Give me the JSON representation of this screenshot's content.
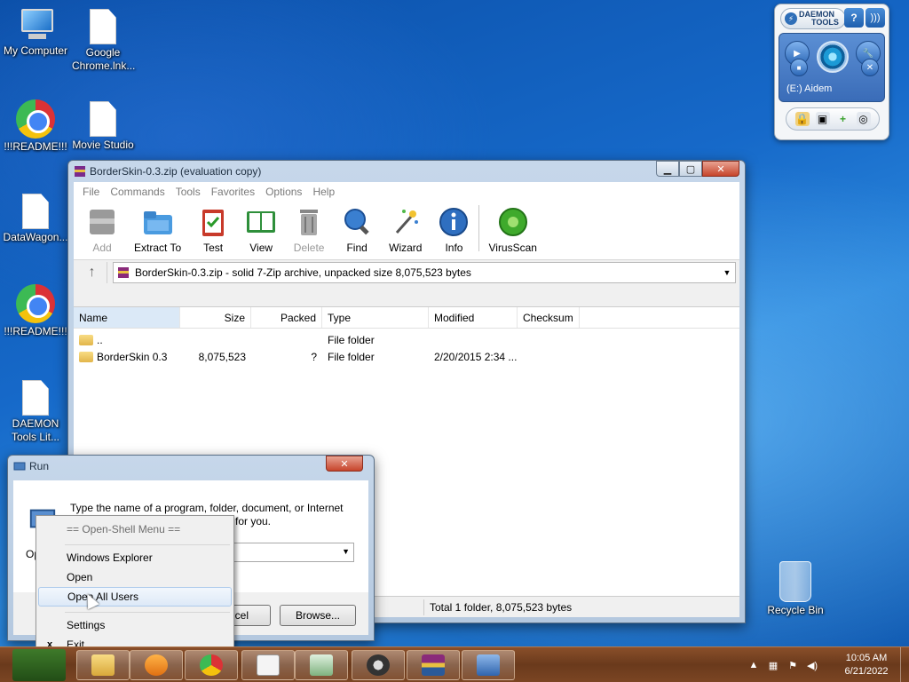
{
  "desktop": {
    "icons": [
      {
        "label": "My Computer"
      },
      {
        "label": "Google Chrome.lnk..."
      },
      {
        "label": "!!!README!!!"
      },
      {
        "label": "Movie Studio"
      },
      {
        "label": "DataWagon..."
      },
      {
        "label": "!!!README!!!"
      },
      {
        "label": "DAEMON Tools Lit..."
      },
      {
        "label": "Recycle Bin"
      }
    ]
  },
  "winrar": {
    "title": "BorderSkin-0.3.zip (evaluation copy)",
    "menu": [
      "File",
      "Commands",
      "Tools",
      "Favorites",
      "Options",
      "Help"
    ],
    "toolbar": {
      "add": "Add",
      "extract_to": "Extract To",
      "test": "Test",
      "view": "View",
      "delete": "Delete",
      "find": "Find",
      "wizard": "Wizard",
      "info": "Info",
      "virusscan": "VirusScan"
    },
    "address": "BorderSkin-0.3.zip - solid 7-Zip archive, unpacked size 8,075,523 bytes",
    "columns": {
      "name": "Name",
      "size": "Size",
      "packed": "Packed",
      "type": "Type",
      "modified": "Modified",
      "checksum": "Checksum"
    },
    "rows": [
      {
        "name": "..",
        "size": "",
        "packed": "",
        "type": "File folder",
        "modified": ""
      },
      {
        "name": "BorderSkin 0.3",
        "size": "8,075,523",
        "packed": "?",
        "type": "File folder",
        "modified": "2/20/2015 2:34 ..."
      }
    ],
    "status": "Total 1 folder, 8,075,523 bytes"
  },
  "run": {
    "title": "Run",
    "text": "Type the name of a program, folder, document, or Internet",
    "text2": "for you.",
    "open_label": "Op",
    "cancel_partial": "ncel",
    "browse": "Browse..."
  },
  "context_menu": {
    "header": "== Open-Shell Menu ==",
    "items": [
      "Windows Explorer",
      "Open",
      "Open All Users",
      "Settings",
      "Exit"
    ],
    "exit_mark": "x"
  },
  "daemon": {
    "brand_line1": "DAEMON",
    "brand_line2": "TOOLS",
    "help": "?",
    "drive": "(E:) Aidem"
  },
  "taskbar": {
    "time": "10:05 AM",
    "date": "6/21/2022"
  }
}
